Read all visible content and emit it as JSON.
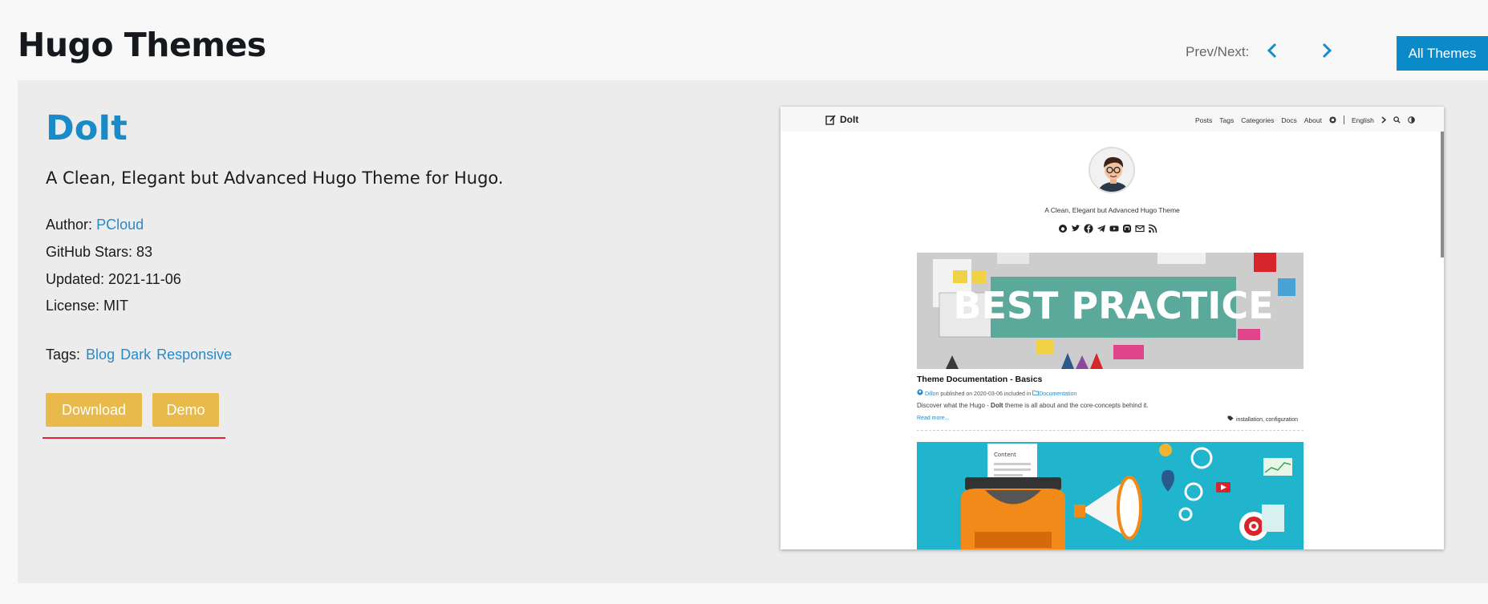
{
  "header": {
    "title": "Hugo Themes",
    "prevnext_label": "Prev/Next:",
    "all_themes_label": "All Themes"
  },
  "theme": {
    "name": "DoIt",
    "description": "A Clean, Elegant but Advanced Hugo Theme for Hugo.",
    "author_label": "Author:",
    "author": "PCloud",
    "stars_text": "GitHub Stars: 83",
    "updated_text": "Updated: 2021-11-06",
    "license_text": "License: MIT",
    "tags_label": "Tags:",
    "tags": [
      "Blog",
      "Dark",
      "Responsive"
    ],
    "download_label": "Download",
    "demo_label": "Demo"
  },
  "preview": {
    "logo": "DoIt",
    "nav": [
      "Posts",
      "Tags",
      "Categories",
      "Docs",
      "About"
    ],
    "language": "English",
    "tagline": "A Clean, Elegant but Advanced Hugo Theme",
    "image1_text": "BEST PRACTICE",
    "post_title": "Theme Documentation - Basics",
    "post_author": "Dillon",
    "post_meta_mid": " published on 2020-03-06 included in ",
    "post_category": "Documentation",
    "post_summary_pre": "Discover what the Hugo - ",
    "post_summary_bold": "DoIt",
    "post_summary_post": " theme is all about and the core-concepts behind it.",
    "read_more": "Read more...",
    "post_tags": "installation, configuration",
    "image2_caption": "Content"
  },
  "colors": {
    "accent": "#0b8ac9",
    "link": "#2a8ac6",
    "button": "#e8b94b",
    "underline": "#e0272d",
    "panel": "#ececec"
  }
}
